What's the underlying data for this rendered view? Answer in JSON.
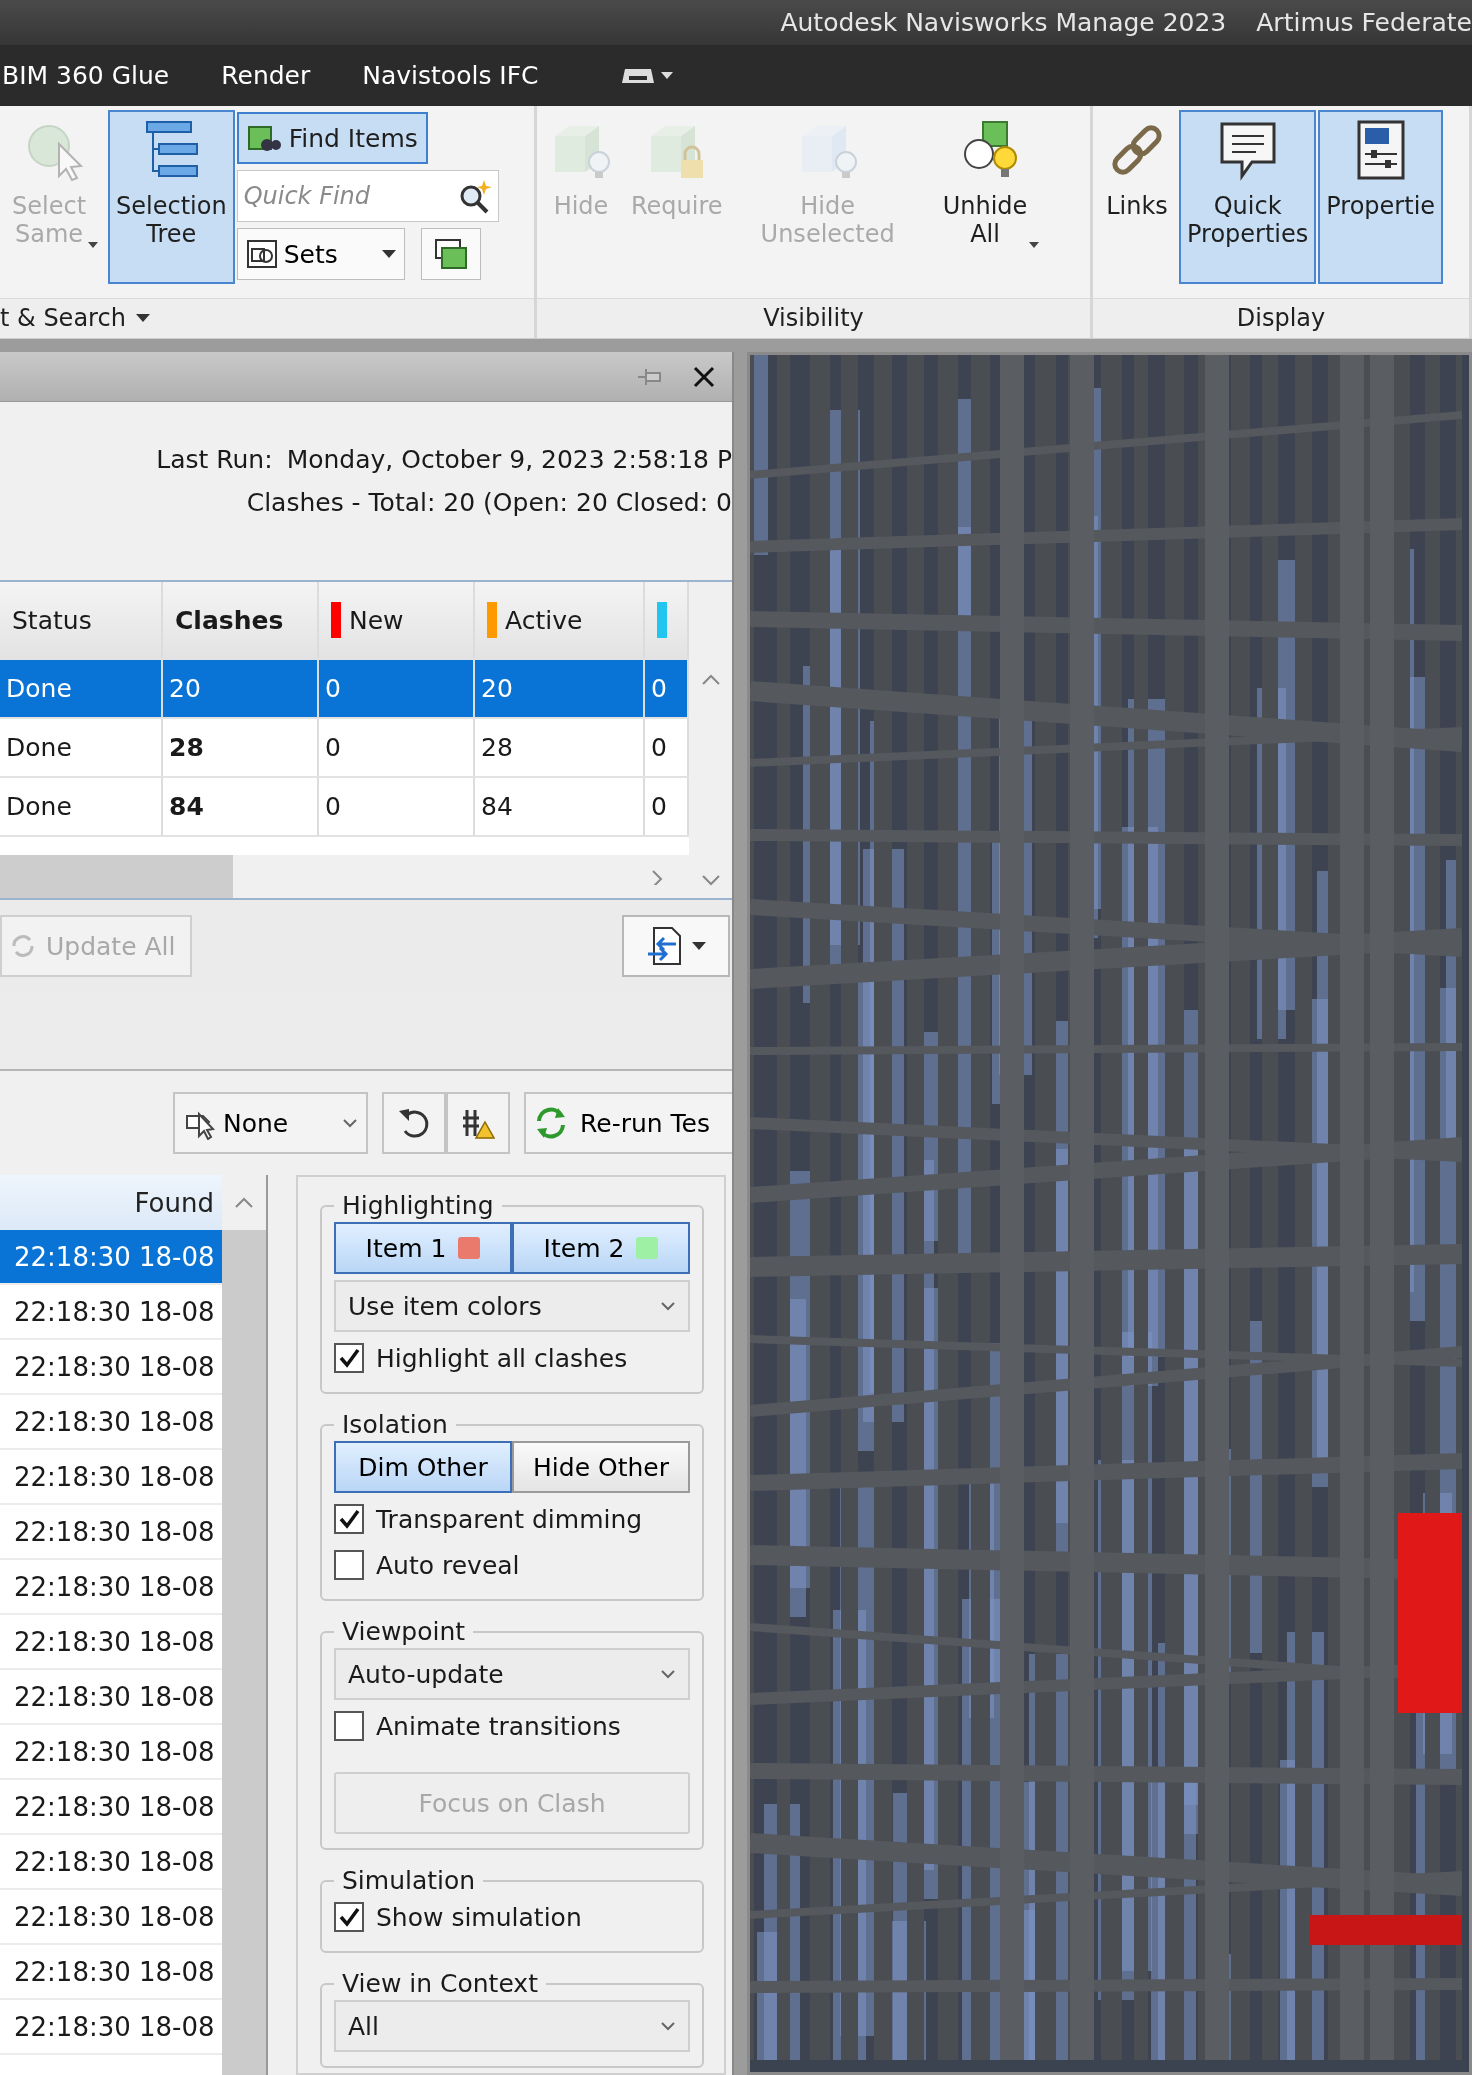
{
  "title_bar": {
    "title": "Autodesk Navisworks Manage 2023",
    "document": "Artimus Federate"
  },
  "menu_tabs": [
    {
      "label": "BIM 360 Glue"
    },
    {
      "label": "Render"
    },
    {
      "label": "Navistools IFC"
    }
  ],
  "ribbon": {
    "panels": [
      {
        "label": "t & Search",
        "menu": true,
        "tools": [
          {
            "kind": "large",
            "lines": [
              "Select",
              "Same"
            ],
            "disabled": true,
            "caret": true,
            "pressed": false
          },
          {
            "kind": "large",
            "lines": [
              "Selection",
              "Tree"
            ],
            "disabled": false,
            "caret": false,
            "pressed": true
          },
          {
            "kind": "stack",
            "find_items": {
              "label": "Find Items",
              "pressed": true
            },
            "quick_find": {
              "placeholder": "Quick Find"
            },
            "sets": {
              "label": "Sets"
            }
          }
        ]
      },
      {
        "label": "Visibility",
        "menu": false,
        "tools": [
          {
            "kind": "large",
            "lines": [
              "Hide"
            ],
            "disabled": true,
            "caret": false,
            "pressed": false
          },
          {
            "kind": "large",
            "lines": [
              "Require"
            ],
            "disabled": true,
            "caret": false,
            "pressed": false
          },
          {
            "kind": "large",
            "lines": [
              "Hide",
              "Unselected"
            ],
            "disabled": true,
            "caret": false,
            "pressed": false
          },
          {
            "kind": "large",
            "lines": [
              "Unhide",
              "All"
            ],
            "disabled": false,
            "caret": true,
            "pressed": false
          }
        ]
      },
      {
        "label": "Display",
        "menu": false,
        "tools": [
          {
            "kind": "large",
            "lines": [
              "Links"
            ],
            "disabled": false,
            "caret": false,
            "pressed": false
          },
          {
            "kind": "large",
            "lines": [
              "Quick",
              "Properties"
            ],
            "disabled": false,
            "caret": false,
            "pressed": true
          },
          {
            "kind": "large",
            "lines": [
              "Propertie"
            ],
            "disabled": false,
            "caret": false,
            "pressed": true
          }
        ]
      }
    ]
  },
  "clash_pane": {
    "last_run": {
      "label": "Last Run:",
      "value": "Monday, October 9, 2023 2:58:18 P"
    },
    "summary": "Clashes -  Total:  20  (Open:  20  Closed:  0",
    "tests_table": {
      "columns": [
        {
          "label": "Status",
          "bold": false
        },
        {
          "label": "Clashes",
          "bold": true
        },
        {
          "label": "New",
          "bold": false,
          "color": "#ff0000"
        },
        {
          "label": "Active",
          "bold": false,
          "color": "#ff9900"
        },
        {
          "color": "#22c4f0"
        }
      ],
      "rows": [
        {
          "selected": true,
          "cells": [
            "Done",
            "20",
            "0",
            "20",
            "0"
          ]
        },
        {
          "selected": false,
          "cells": [
            "Done",
            "28",
            "0",
            "28",
            "0"
          ]
        },
        {
          "selected": false,
          "cells": [
            "Done",
            "84",
            "0",
            "84",
            "0"
          ]
        }
      ]
    },
    "update_all": {
      "label": "Update All",
      "disabled": true
    },
    "toolbar": {
      "assign": {
        "label": "None"
      },
      "rerun": {
        "label": "Re-run Tes"
      }
    },
    "results": {
      "header": "Found",
      "rows": [
        {
          "found": "22:18:30 18-08",
          "selected": true
        },
        {
          "found": "22:18:30 18-08",
          "selected": false
        },
        {
          "found": "22:18:30 18-08",
          "selected": false
        },
        {
          "found": "22:18:30 18-08",
          "selected": false
        },
        {
          "found": "22:18:30 18-08",
          "selected": false
        },
        {
          "found": "22:18:30 18-08",
          "selected": false
        },
        {
          "found": "22:18:30 18-08",
          "selected": false
        },
        {
          "found": "22:18:30 18-08",
          "selected": false
        },
        {
          "found": "22:18:30 18-08",
          "selected": false
        },
        {
          "found": "22:18:30 18-08",
          "selected": false
        },
        {
          "found": "22:18:30 18-08",
          "selected": false
        },
        {
          "found": "22:18:30 18-08",
          "selected": false
        },
        {
          "found": "22:18:30 18-08",
          "selected": false
        },
        {
          "found": "22:18:30 18-08",
          "selected": false
        },
        {
          "found": "22:18:30 18-08",
          "selected": false
        }
      ]
    },
    "settings": [
      {
        "title": "Highlighting",
        "items": [
          {
            "kind": "segmented",
            "options": [
              {
                "label": "Item 1",
                "selected": true,
                "color": "#e97a6c"
              },
              {
                "label": "Item 2",
                "selected": true,
                "color": "#9ef0a4"
              }
            ]
          },
          {
            "kind": "dropdown",
            "value": "Use item colors"
          },
          {
            "kind": "checkbox",
            "label": "Highlight all clashes",
            "checked": true
          }
        ]
      },
      {
        "title": "Isolation",
        "items": [
          {
            "kind": "segmented",
            "options": [
              {
                "label": "Dim Other",
                "selected": true
              },
              {
                "label": "Hide Other",
                "selected": false
              }
            ]
          },
          {
            "kind": "checkbox",
            "label": "Transparent dimming",
            "checked": true
          },
          {
            "kind": "checkbox",
            "label": "Auto reveal",
            "checked": false
          }
        ]
      },
      {
        "title": "Viewpoint",
        "items": [
          {
            "kind": "dropdown",
            "value": "Auto-update"
          },
          {
            "kind": "checkbox",
            "label": "Animate transitions",
            "checked": false
          },
          {
            "kind": "button",
            "label": "Focus on Clash",
            "disabled": true
          }
        ]
      },
      {
        "title": "Simulation",
        "items": [
          {
            "kind": "checkbox",
            "label": "Show simulation",
            "checked": true
          }
        ]
      },
      {
        "title": "View in Context",
        "items": [
          {
            "kind": "dropdown",
            "value": "All"
          }
        ]
      }
    ]
  }
}
